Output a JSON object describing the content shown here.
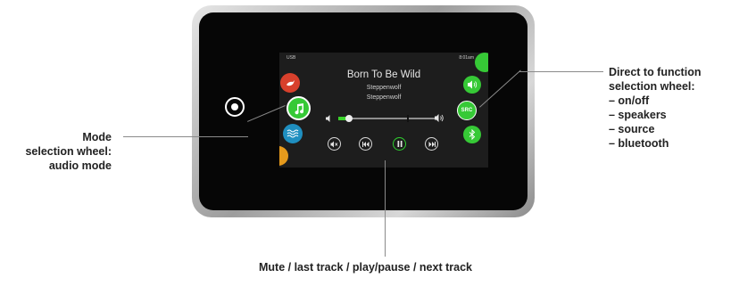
{
  "screen": {
    "source_label": "USB",
    "time": "8:01am",
    "song_title": "Born To Be Wild",
    "artist": "Steppenwolf",
    "album": "Steppenwolf",
    "src_label": "SRC"
  },
  "callouts": {
    "mode": [
      "Mode",
      "selection wheel:",
      "audio mode"
    ],
    "direct": [
      "Direct to function",
      "selection wheel:",
      "– on/off",
      "– speakers",
      "– source",
      "– bluetooth"
    ],
    "bottom": "Mute / last track / play/pause / next track"
  },
  "colors": {
    "accent_green": "#36c936",
    "mode_red": "#d8402c",
    "mode_blue": "#1f8fc0",
    "mode_orange": "#e59a1c"
  },
  "icons": [
    "power-icon",
    "bird-icon",
    "music-note-icon",
    "waves-icon",
    "volume-low-icon",
    "volume-high-icon",
    "speaker-icon",
    "bluetooth-icon",
    "mute-icon",
    "previous-track-icon",
    "play-pause-icon",
    "next-track-icon"
  ]
}
